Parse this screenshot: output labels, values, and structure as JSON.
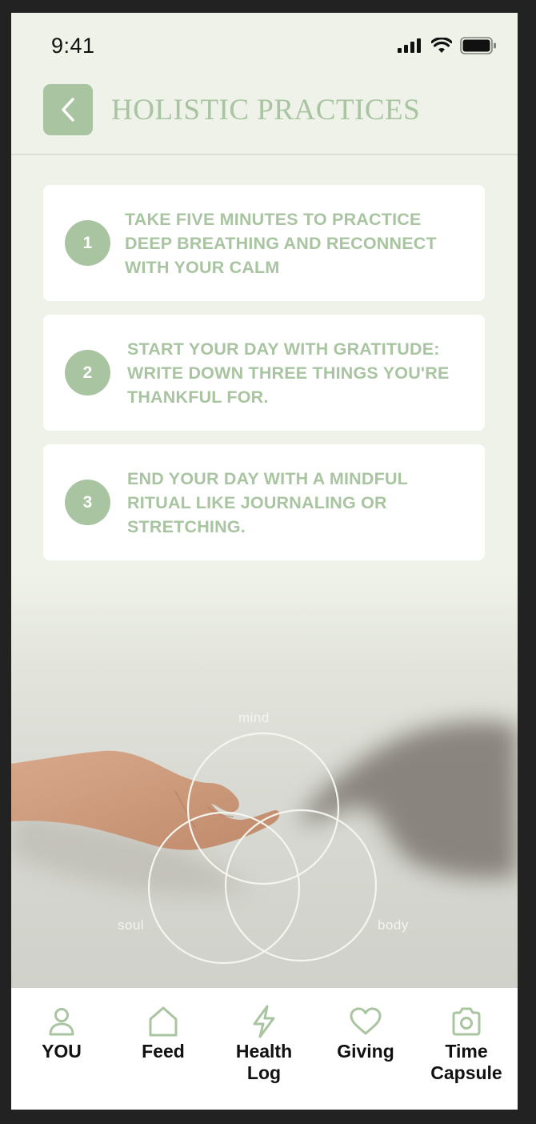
{
  "status_bar": {
    "time": "9:41"
  },
  "header": {
    "title": "HOLISTIC PRACTICES"
  },
  "practices": [
    {
      "number": "1",
      "text": "TAKE FIVE MINUTES TO PRACTICE DEEP BREATHING AND RECONNECT WITH YOUR CALM"
    },
    {
      "number": "2",
      "text": "START YOUR DAY WITH GRATITUDE: WRITE DOWN THREE THINGS YOU'RE THANKFUL FOR."
    },
    {
      "number": "3",
      "text": "END YOUR DAY WITH A MINDFUL RITUAL LIKE JOURNALING OR STRETCHING."
    }
  ],
  "venn": {
    "top": "mind",
    "left": "soul",
    "right": "body"
  },
  "tabs": [
    {
      "label": "YOU",
      "icon": "person-icon"
    },
    {
      "label": "Feed",
      "icon": "home-icon"
    },
    {
      "label": "Health\nLog",
      "icon": "lightning-icon"
    },
    {
      "label": "Giving",
      "icon": "heart-icon"
    },
    {
      "label": "Time\nCapsule",
      "icon": "camera-icon"
    }
  ],
  "colors": {
    "accent": "#a9c4a1",
    "background": "#eff2e8",
    "frame": "#222222"
  }
}
